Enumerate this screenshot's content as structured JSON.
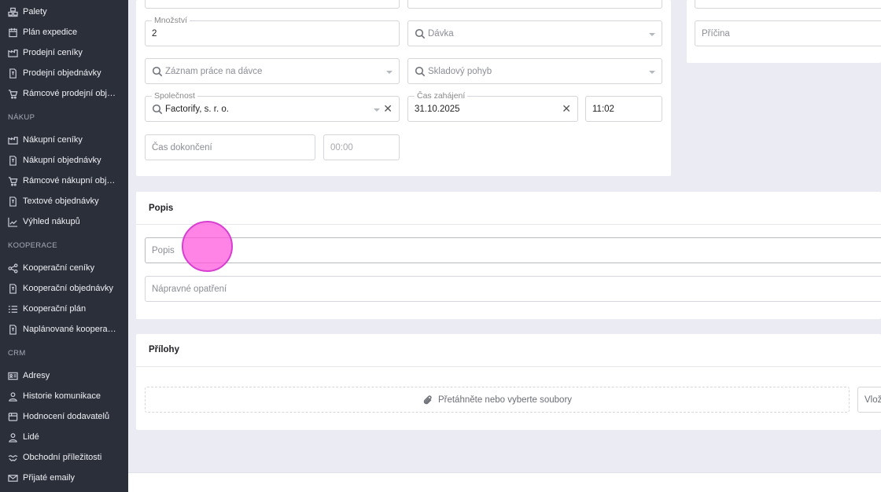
{
  "sidebar": {
    "items": [
      {
        "label": "Palety",
        "icon": "pallet-icon"
      },
      {
        "label": "Plán expedice",
        "icon": "calendar-icon"
      },
      {
        "label": "Prodejní ceníky",
        "icon": "pricelist-icon"
      },
      {
        "label": "Prodejní objednávky",
        "icon": "document-icon"
      },
      {
        "label": "Rámcové prodejní objed...",
        "icon": "cart-icon"
      },
      {
        "label": "Nákupní ceníky",
        "icon": "pricelist-icon"
      },
      {
        "label": "Nákupní objednávky",
        "icon": "document-icon"
      },
      {
        "label": "Rámcové nákupní objed...",
        "icon": "cart-icon"
      },
      {
        "label": "Textové objednávky",
        "icon": "document-icon"
      },
      {
        "label": "Výhled nákupů",
        "icon": "trend-chart-icon"
      },
      {
        "label": "Kooperační ceníky",
        "icon": "share-icon"
      },
      {
        "label": "Kooperační objednávky",
        "icon": "document-icon"
      },
      {
        "label": "Kooperační plán",
        "icon": "list-icon"
      },
      {
        "label": "Naplánované kooperačn...",
        "icon": "document-icon"
      },
      {
        "label": "Adresy",
        "icon": "address-card-icon"
      },
      {
        "label": "Historie komunikace",
        "icon": "person-icon"
      },
      {
        "label": "Hodnocení dodavatelů",
        "icon": "rating-box-icon"
      },
      {
        "label": "Lidé",
        "icon": "person-icon"
      },
      {
        "label": "Obchodní příležitosti",
        "icon": "handshake-icon"
      },
      {
        "label": "Přijaté emaily",
        "icon": "mail-icon"
      }
    ],
    "sections": {
      "nakup": "NÁKUP",
      "kooperace": "KOOPERACE",
      "crm": "CRM"
    }
  },
  "form": {
    "mnozstvi_label": "Množství",
    "mnozstvi_value": "2",
    "davka_placeholder": "Dávka",
    "zaznam_placeholder": "Záznam práce na dávce",
    "skladovy_placeholder": "Skladový pohyb",
    "spolecnost_label": "Společnost",
    "spolecnost_value": "Factorify, s. r. o.",
    "cas_zahajeni_label": "Čas zahájení",
    "cas_zahajeni_date": "31.10.2025",
    "cas_zahajeni_time": "11:02",
    "cas_dokonceni_placeholder": "Čas dokončení",
    "cas_dokonceni_time_placeholder": "00:00",
    "pricina_placeholder": "Příčina"
  },
  "popis_section": {
    "title": "Popis",
    "popis_placeholder": "Popis",
    "napravne_placeholder": "Nápravné opatření"
  },
  "prilohy_section": {
    "title": "Přílohy",
    "dropzone_text": "Přetáhněte nebo vyberte soubory",
    "insert_button_label": "Vlož"
  }
}
